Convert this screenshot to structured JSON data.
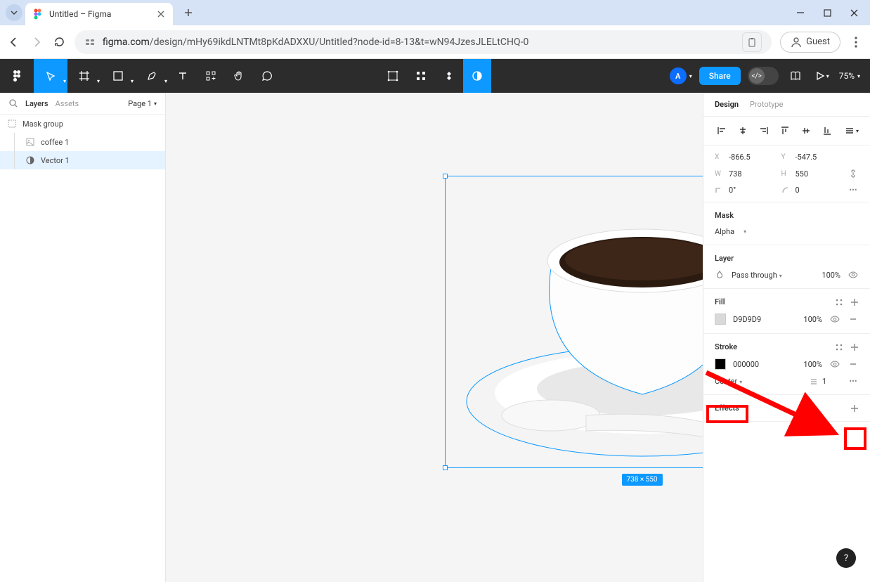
{
  "browser": {
    "tab_title": "Untitled – Figma",
    "url_prefix": "figma.com",
    "url_path": "/design/mHy69ikdLNTMt8pKdADXXU/Untitled?node-id=8-13&t=wN94JzesJLELtCHQ-0",
    "guest_label": "Guest"
  },
  "toolbar": {
    "avatar_initial": "A",
    "share_label": "Share",
    "zoom_label": "75%"
  },
  "left_panel": {
    "tab_layers": "Layers",
    "tab_assets": "Assets",
    "page_label": "Page 1",
    "layers": {
      "group": "Mask group",
      "img": "coffee 1",
      "vector": "Vector 1"
    }
  },
  "canvas": {
    "dimensions_badge": "738 × 550"
  },
  "right_panel": {
    "tab_design": "Design",
    "tab_prototype": "Prototype",
    "pos": {
      "x_label": "X",
      "x": "-866.5",
      "y_label": "Y",
      "y": "-547.5",
      "w_label": "W",
      "w": "738",
      "h_label": "H",
      "h": "550",
      "rot_label": "⌐",
      "rot": "0°",
      "radius_label": "⌒",
      "radius": "0"
    },
    "mask": {
      "title": "Mask",
      "mode": "Alpha"
    },
    "layer": {
      "title": "Layer",
      "blend": "Pass through",
      "opacity": "100%"
    },
    "fill": {
      "title": "Fill",
      "hex": "D9D9D9",
      "opacity": "100%"
    },
    "stroke": {
      "title": "Stroke",
      "hex": "000000",
      "opacity": "100%",
      "align": "Center",
      "weight": "1"
    },
    "effects": {
      "title": "Effects"
    }
  },
  "help": "?"
}
